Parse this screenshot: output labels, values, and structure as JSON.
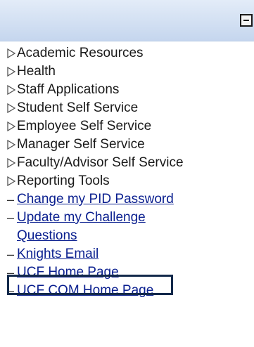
{
  "menu": {
    "folders": [
      {
        "label": "Academic Resources"
      },
      {
        "label": "Health"
      },
      {
        "label": "Staff Applications"
      },
      {
        "label": "Student Self Service"
      },
      {
        "label": "Employee Self Service"
      },
      {
        "label": "Manager Self Service"
      },
      {
        "label": "Faculty/Advisor Self Service"
      },
      {
        "label": "Reporting Tools"
      }
    ],
    "links": [
      {
        "line1": "Change my PID Password"
      },
      {
        "line1": "Update my Challenge",
        "line2": "Questions"
      },
      {
        "line1": "Knights Email"
      },
      {
        "line1": "UCF Home Page"
      },
      {
        "line1": "UCF COM Home Page"
      }
    ]
  },
  "colors": {
    "header_gradient_top": "#e3ecf8",
    "header_gradient_bottom": "#c5d6ee",
    "link": "#0a1f8f",
    "highlight_border": "#13294b"
  },
  "icons": {
    "collapse": "minus-box-icon",
    "folder": "triangle-right-icon",
    "link_bullet": "dash-icon"
  }
}
